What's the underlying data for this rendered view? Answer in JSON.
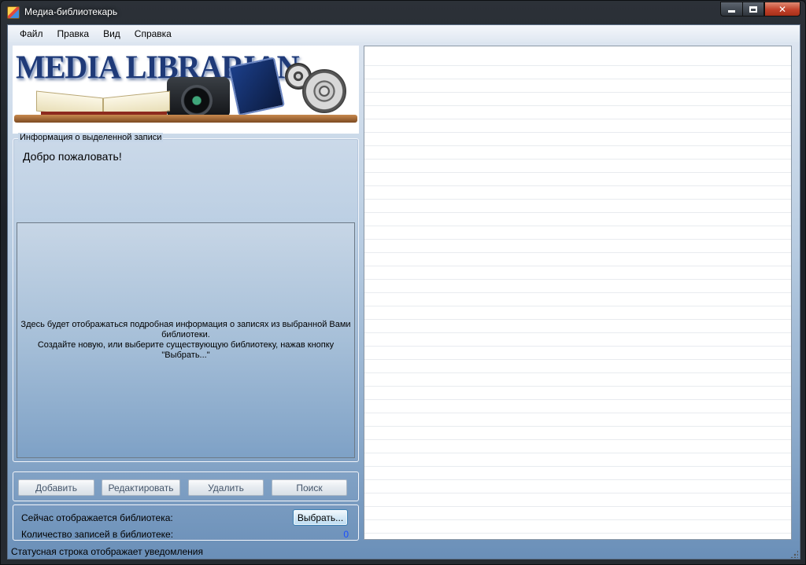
{
  "window": {
    "title": "Медиа-библиотекарь",
    "controls": {
      "minimize": "–",
      "maximize": "□",
      "close": "✕"
    }
  },
  "menu": {
    "items": [
      {
        "label": "Файл"
      },
      {
        "label": "Правка"
      },
      {
        "label": "Вид"
      },
      {
        "label": "Справка"
      }
    ]
  },
  "banner": {
    "title": "MEDIA LIBRARIAN"
  },
  "info": {
    "legend": "Информация о выделенной записи",
    "welcome": "Добро пожаловать!",
    "detail_line1": "Здесь будет отображаться подробная информация о записях из выбранной Вами библиотеки.",
    "detail_line2": "Создайте новую, или выберите существующую библиотеку, нажав кнопку \"Выбрать...\""
  },
  "actions": {
    "add_label": "Добавить",
    "edit_label": "Редактировать",
    "delete_label": "Удалить",
    "search_label": "Поиск"
  },
  "library": {
    "current_label": "Сейчас отображается библиотека:",
    "choose_label": "Выбрать...",
    "count_label": "Количество записей в библиотеке:",
    "count_value": "0"
  },
  "status": {
    "text": "Статусная строка отображает уведомления"
  },
  "colors": {
    "count_value": "#1a4dff",
    "banner_title": "#1f3a78"
  }
}
